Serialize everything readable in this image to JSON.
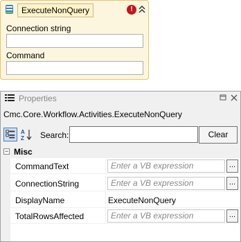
{
  "activity": {
    "title": "ExecuteNonQuery",
    "connection_label": "Connection string",
    "connection_value": "",
    "command_label": "Command",
    "command_value": "",
    "warning_symbol": "!"
  },
  "properties": {
    "title": "Properties",
    "type_name": "Cmc.Core.Workflow.Activities.ExecuteNonQuery",
    "search_label": "Search:",
    "search_value": "",
    "clear_label": "Clear",
    "category": "Misc",
    "category_toggle": "−",
    "rows": [
      {
        "name": "CommandText",
        "value": "Enter a VB expression",
        "button": "..."
      },
      {
        "name": "ConnectionString",
        "value": "Enter a VB expression",
        "button": "..."
      },
      {
        "name": "DisplayName",
        "value": "ExecuteNonQuery"
      },
      {
        "name": "TotalRowsAffected",
        "value": "Enter a VB expression",
        "button": "..."
      }
    ]
  },
  "colors": {
    "activity_bg": "#fdf6de",
    "activity_border": "#e9c46a",
    "warning": "#c4161c",
    "panel_bg": "#f0f0f0"
  },
  "icons": [
    "activity-db-icon",
    "warning-icon",
    "collapse-chevron-icon",
    "properties-icon",
    "pin-icon",
    "close-icon",
    "categorized-icon",
    "alphabetical-sort-icon"
  ]
}
